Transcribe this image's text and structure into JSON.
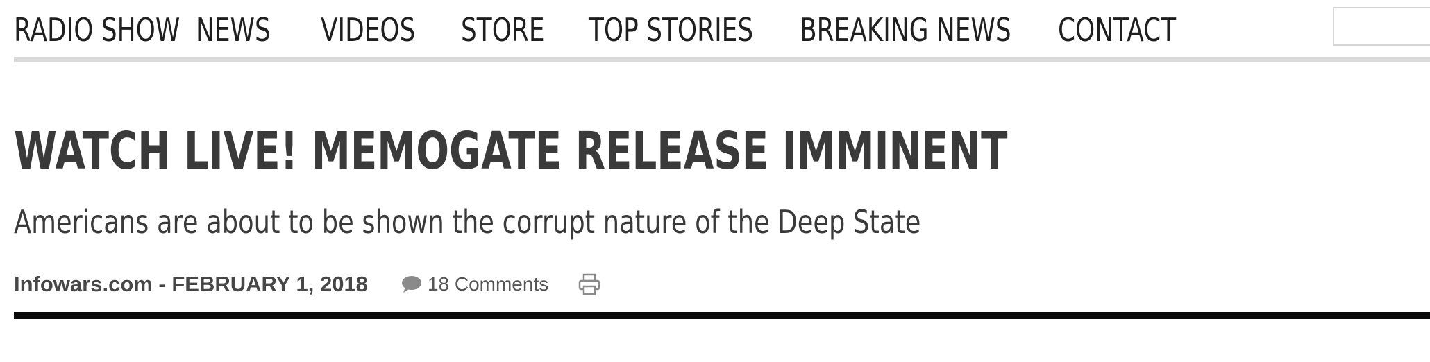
{
  "nav": {
    "items": [
      {
        "label": "RADIO SHOW"
      },
      {
        "label": "NEWS"
      },
      {
        "label": "VIDEOS"
      },
      {
        "label": "STORE"
      },
      {
        "label": "TOP STORIES"
      },
      {
        "label": "BREAKING NEWS"
      },
      {
        "label": "CONTACT"
      }
    ],
    "search_value": ""
  },
  "article": {
    "headline": "WATCH LIVE! MEMOGATE RELEASE IMMINENT",
    "subheadline": "Americans are about to be shown the corrupt nature of the Deep State",
    "byline": "Infowars.com - FEBRUARY 1, 2018",
    "comments_label": "18 Comments"
  },
  "icons": {
    "comments": "speech-bubble-icon",
    "print": "printer-icon"
  },
  "colors": {
    "text": "#3a3a3a",
    "nav_rule": "#d9d9d9",
    "divider": "#0a0a0a",
    "icon_gray": "#8a8a8a"
  }
}
